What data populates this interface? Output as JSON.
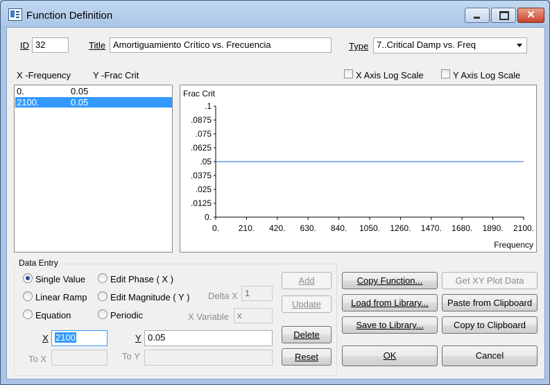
{
  "window": {
    "title": "Function Definition",
    "minimize_icon": "minimize-icon",
    "maximize_icon": "maximize-icon",
    "close_icon": "close-icon",
    "close_glyph": "✕"
  },
  "header": {
    "id_label": "ID",
    "id_value": "32",
    "title_label": "Title",
    "title_value": "Amortiguamiento Crítico vs. Frecuencia",
    "type_label": "Type",
    "type_value": "7..Critical Damp vs. Freq"
  },
  "list": {
    "x_header": "X -Frequency",
    "y_header": "Y -Frac Crit",
    "rows": [
      {
        "x": "0.",
        "y": "0.05"
      },
      {
        "x": "2100.",
        "y": "0.05"
      }
    ],
    "selected_index": 1
  },
  "options": {
    "x_log_label": "X Axis Log Scale",
    "x_log_checked": false,
    "y_log_label": "Y Axis Log Scale",
    "y_log_checked": false
  },
  "chart_data": {
    "type": "line",
    "ylabel": "Frac Crit",
    "xlabel": "Frequency",
    "x_ticks": [
      "0.",
      "210.",
      "420.",
      "630.",
      "840.",
      "1050.",
      "1260.",
      "1470.",
      "1680.",
      "1890.",
      "2100."
    ],
    "y_ticks": [
      ".1",
      ".0875",
      ".075",
      ".0625",
      ".05",
      ".0375",
      ".025",
      ".0125",
      "0."
    ],
    "xlim": [
      0,
      2100
    ],
    "ylim": [
      0,
      0.1
    ],
    "series": [
      {
        "x": [
          0,
          2100
        ],
        "y": [
          0.05,
          0.05
        ],
        "color": "#6495ed"
      }
    ]
  },
  "data_entry": {
    "group_title": "Data Entry",
    "radios": [
      "Single Value",
      "Linear Ramp",
      "Equation",
      "Edit Phase ( X )",
      "Edit Magnitude ( Y )",
      "Periodic"
    ],
    "selected_radio": "Single Value",
    "delta_x_label": "Delta X",
    "delta_x_value": "1",
    "x_variable_label": "X Variable",
    "x_variable_value": "x",
    "x_label": "X",
    "x_value": "2100",
    "y_label": "Y",
    "y_value": "0.05",
    "to_x_label": "To X",
    "to_x_value": "",
    "to_y_label": "To Y",
    "to_y_value": ""
  },
  "buttons": {
    "add": "Add",
    "update": "Update",
    "delete": "Delete",
    "reset": "Reset",
    "copy_function": "Copy Function...",
    "get_xy_plot_data": "Get XY Plot Data",
    "load_from_library": "Load from Library...",
    "paste_from_clipboard": "Paste from Clipboard",
    "save_to_library": "Save to Library...",
    "copy_to_clipboard": "Copy to Clipboard",
    "ok": "OK",
    "cancel": "Cancel"
  },
  "colors": {
    "selection": "#3399ff",
    "series_line": "#6495ed",
    "window_frame": "#a9c4e6"
  }
}
